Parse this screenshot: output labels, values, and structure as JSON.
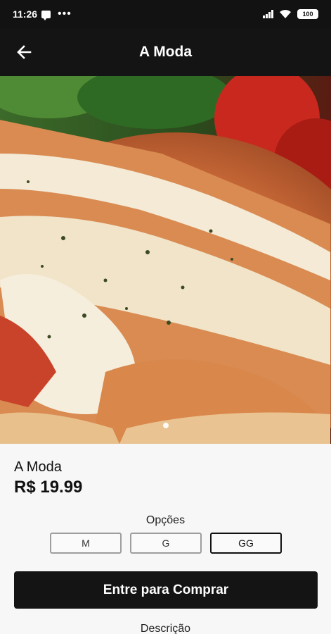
{
  "status_bar": {
    "time": "11:26",
    "more": "•••",
    "battery": "100"
  },
  "app_bar": {
    "title": "A Moda"
  },
  "carousel": {
    "images": [
      "pizza-margherita-photo"
    ],
    "active_index": 0
  },
  "product": {
    "name": "A Moda",
    "price": "R$ 19.99"
  },
  "options": {
    "label": "Opções",
    "sizes": [
      "M",
      "G",
      "GG"
    ],
    "selected": "GG"
  },
  "buy_button": {
    "label": "Entre para Comprar"
  },
  "description": {
    "label": "Descrição"
  },
  "colors": {
    "dark": "#141414",
    "background": "#f7f7f7",
    "option_border": "#9e9e9e"
  }
}
